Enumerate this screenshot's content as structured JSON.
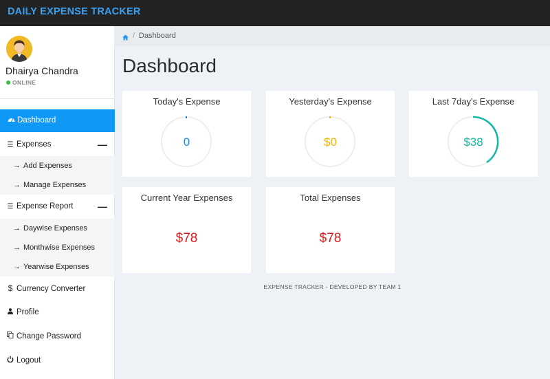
{
  "header": {
    "brand": "DAILY EXPENSE TRACKER"
  },
  "user": {
    "name": "Dhairya Chandra",
    "status": "ONLINE"
  },
  "sidebar": {
    "dashboard": "Dashboard",
    "expenses": "Expenses",
    "add_expenses": "Add Expenses",
    "manage_expenses": "Manage Expenses",
    "expense_report": "Expense Report",
    "daywise": "Daywise Expenses",
    "monthwise": "Monthwise Expenses",
    "yearwise": "Yearwise Expenses",
    "currency": "Currency Converter",
    "profile": "Profile",
    "change_password": "Change Password",
    "logout": "Logout"
  },
  "breadcrumb": {
    "current": "Dashboard"
  },
  "page": {
    "title": "Dashboard"
  },
  "cards": {
    "today": {
      "title": "Today's Expense",
      "value": "0",
      "color": "#1a8cf0"
    },
    "yesterday": {
      "title": "Yesterday's Expense",
      "value": "$0",
      "color": "#f5b400"
    },
    "week": {
      "title": "Last 7day's Expense",
      "value": "$38",
      "color": "#13b7a4"
    },
    "year": {
      "title": "Current Year Expenses",
      "value": "$78"
    },
    "total": {
      "title": "Total Expenses",
      "value": "$78"
    }
  },
  "footer": {
    "text": "EXPENSE TRACKER - DEVELOPED BY TEAM 1"
  }
}
